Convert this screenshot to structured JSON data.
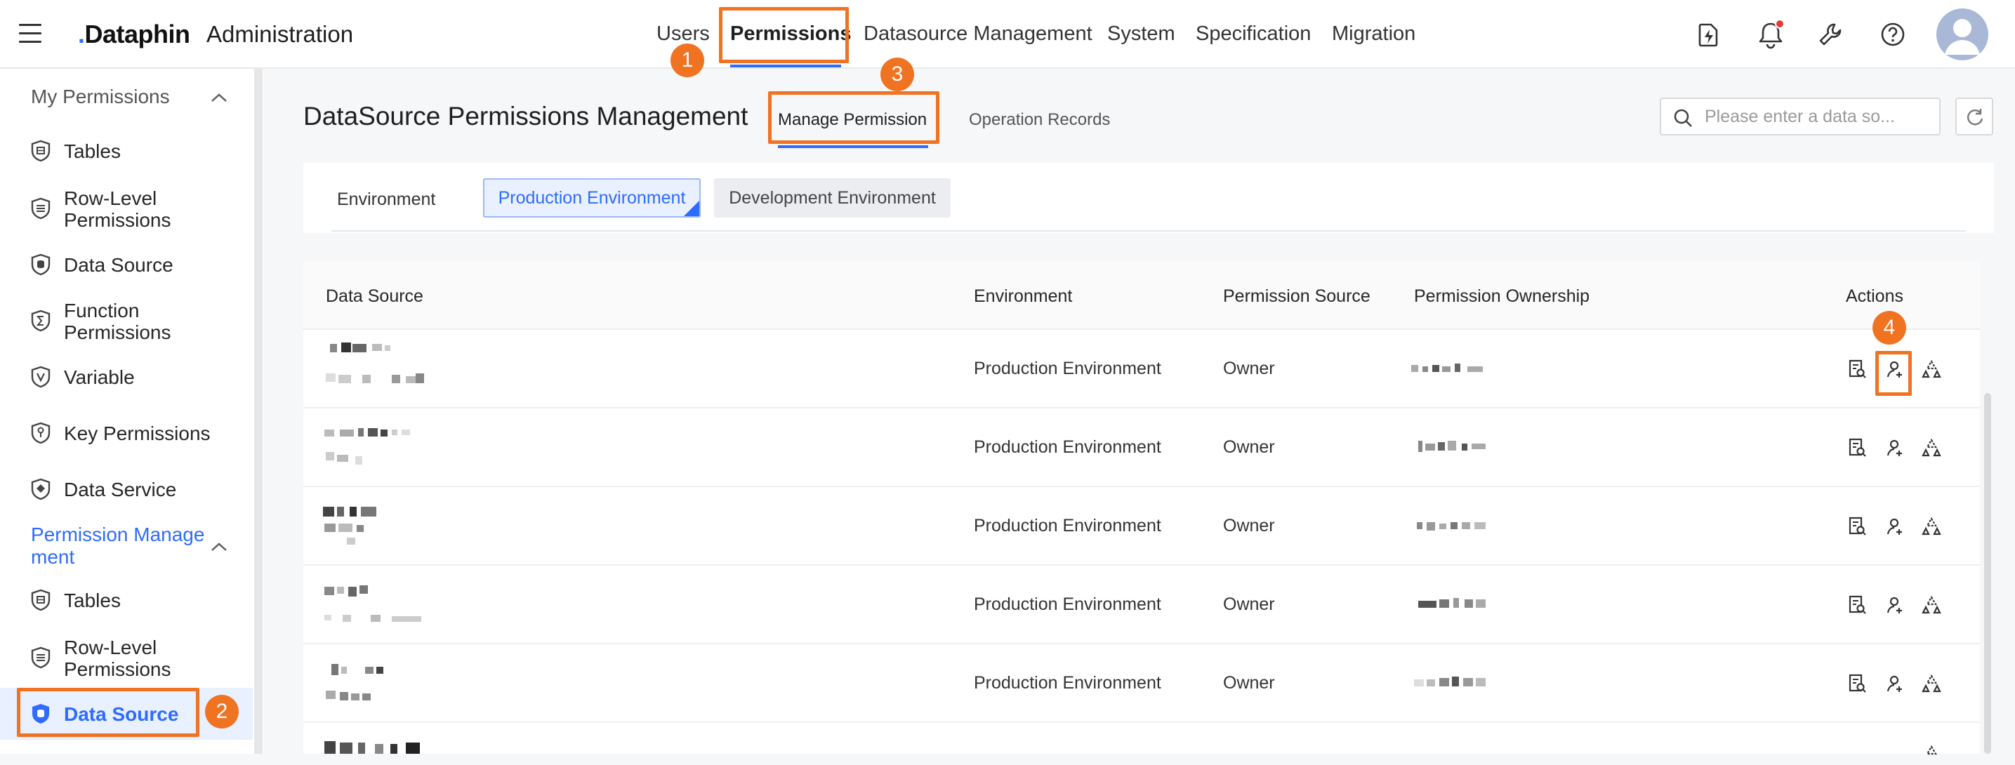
{
  "app": {
    "logo": "Dataphin",
    "title": "Administration"
  },
  "nav": {
    "items": [
      "Users",
      "Permissions",
      "Datasource Management",
      "System",
      "Specification",
      "Migration"
    ],
    "active": "Permissions"
  },
  "top_icons": [
    "lightning-file-icon",
    "bell-icon",
    "wrench-icon",
    "help-icon",
    "user-avatar"
  ],
  "sidebar": {
    "group1": "My Permissions",
    "group1_items": [
      "Tables",
      "Row-Level\nPermissions",
      "Data Source",
      "Function\nPermissions",
      "Variable",
      "Key Permissions",
      "Data Service"
    ],
    "group2": "Permission Manage\nment",
    "group2_items": [
      "Tables",
      "Row-Level\nPermissions",
      "Data Source"
    ],
    "selected": "Data Source"
  },
  "page": {
    "title": "DataSource Permissions Management",
    "tabs": [
      "Manage Permission",
      "Operation Records"
    ],
    "active_tab": "Manage Permission",
    "search_placeholder": "Please enter a data so..."
  },
  "environment": {
    "label": "Environment",
    "options": [
      "Production Environment",
      "Development Environment"
    ],
    "selected": "Production Environment"
  },
  "table": {
    "columns": [
      "Data Source",
      "Environment",
      "Permission Source",
      "Permission Ownership",
      "Actions"
    ],
    "rows": [
      {
        "environment": "Production Environment",
        "permission_source": "Owner"
      },
      {
        "environment": "Production Environment",
        "permission_source": "Owner"
      },
      {
        "environment": "Production Environment",
        "permission_source": "Owner"
      },
      {
        "environment": "Production Environment",
        "permission_source": "Owner"
      },
      {
        "environment": "Production Environment",
        "permission_source": "Owner"
      }
    ],
    "action_icons": [
      "view-details-icon",
      "user-permission-icon",
      "permission-tree-icon"
    ]
  },
  "callouts": [
    "1",
    "2",
    "3",
    "4"
  ],
  "colors": {
    "accent": "#2f6bff",
    "callout": "#f07321",
    "notification": "#e53935"
  }
}
